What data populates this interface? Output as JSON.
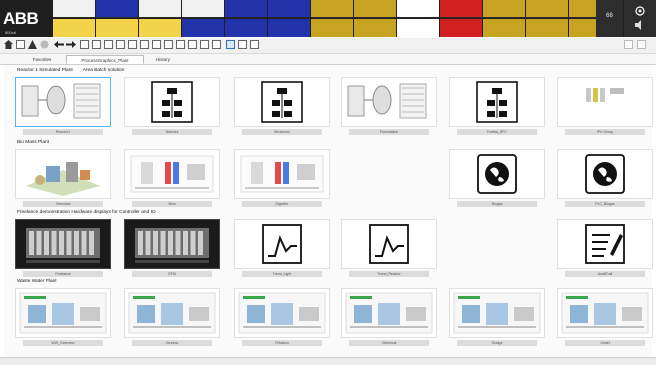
{
  "header": {
    "logo": "ABB",
    "logo_sub": "800xA",
    "alarm_tiles": [
      {
        "top_color": "#f0f0f0",
        "bot_color": "#f3d34a",
        "top_text": "",
        "bot_text": ""
      },
      {
        "top_color": "#2233aa",
        "bot_color": "#f3d34a",
        "top_text": "",
        "bot_text": ""
      },
      {
        "top_color": "#f0f0f0",
        "bot_color": "#f3d34a",
        "top_text": "",
        "bot_text": ""
      },
      {
        "top_color": "#f0f0f0",
        "bot_color": "#2233aa",
        "top_text": "",
        "bot_text": ""
      },
      {
        "top_color": "#2233aa",
        "bot_color": "#2233aa",
        "top_text": "",
        "bot_text": ""
      },
      {
        "top_color": "#2233aa",
        "bot_color": "#2233aa",
        "top_text": "",
        "bot_text": ""
      },
      {
        "top_color": "#c8a321",
        "bot_color": "#c8a321",
        "top_text": "",
        "bot_text": ""
      },
      {
        "top_color": "#c8a321",
        "bot_color": "#c8a321",
        "top_text": "",
        "bot_text": ""
      },
      {
        "top_color": "#ffffff",
        "bot_color": "#ffffff",
        "top_text": "",
        "bot_text": ""
      },
      {
        "top_color": "#d12020",
        "bot_color": "#d12020",
        "top_text": "",
        "bot_text": ""
      },
      {
        "top_color": "#c8a321",
        "bot_color": "#c8a321",
        "top_text": "",
        "bot_text": ""
      },
      {
        "top_color": "#c8a321",
        "bot_color": "#c8a321",
        "top_text": "",
        "bot_text": ""
      },
      {
        "top_color": "#c8a321",
        "bot_color": "#c8a321",
        "top_text": "",
        "bot_text": ""
      }
    ]
  },
  "tabs": [
    {
      "label": "Favorites"
    },
    {
      "label": "ProcessGraphics_Plant"
    },
    {
      "label": "History"
    }
  ],
  "sections": [
    {
      "title": "Reactor 1 Simulated Plant",
      "sub": "Area Batch solution"
    },
    {
      "title": "Bio Mass Plant",
      "sub": ""
    },
    {
      "title": "Freelance demonstration Hardware displays for Controller and IO",
      "sub": ""
    },
    {
      "title": "Waste Water Plant",
      "sub": ""
    }
  ],
  "rows": [
    [
      {
        "caption": "Reactor1",
        "kind": "plant"
      },
      {
        "caption": "Batches",
        "kind": "hier"
      },
      {
        "caption": "Structures",
        "kind": "hier"
      },
      {
        "caption": "Formulation",
        "kind": "plant2"
      },
      {
        "caption": "Fortiba_SFC",
        "kind": "hier"
      },
      {
        "caption": "IPU Group",
        "kind": "bars"
      }
    ],
    [
      {
        "caption": "Overview",
        "kind": "iso"
      },
      {
        "caption": "Silos",
        "kind": "pid"
      },
      {
        "caption": "Digester",
        "kind": "pid"
      },
      {
        "caption": "Biogas",
        "kind": "globe"
      },
      {
        "caption": "PLC_Biogas",
        "kind": "globe"
      }
    ],
    [
      {
        "caption": "Freelance",
        "kind": "rack"
      },
      {
        "caption": "DTM",
        "kind": "rack"
      },
      {
        "caption": "Trend_Light",
        "kind": "trend"
      },
      {
        "caption": "Trend_Reactor",
        "kind": "trend"
      },
      {
        "caption": "AuditTrail",
        "kind": "form"
      }
    ],
    [
      {
        "caption": "WW_Overview",
        "kind": "ww"
      },
      {
        "caption": "Screens",
        "kind": "ww"
      },
      {
        "caption": "Filtration",
        "kind": "ww"
      },
      {
        "caption": "Chemical",
        "kind": "ww"
      },
      {
        "caption": "Sludge",
        "kind": "ww"
      },
      {
        "caption": "Outlet",
        "kind": "ww"
      }
    ]
  ],
  "status": {
    "left": "",
    "right": ""
  }
}
